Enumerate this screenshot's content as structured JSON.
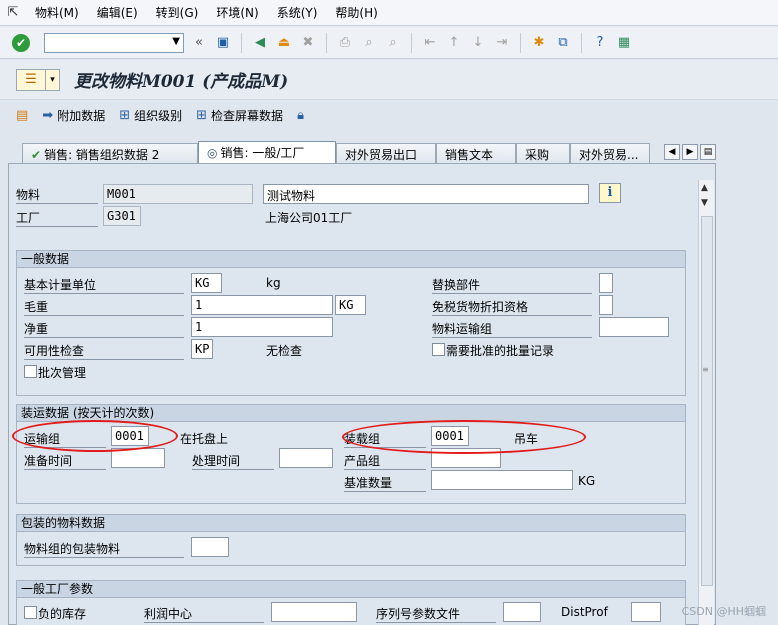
{
  "menubar": {
    "items": [
      "物料(M)",
      "编辑(E)",
      "转到(G)",
      "环境(N)",
      "系统(Y)",
      "帮助(H)"
    ]
  },
  "toolbar": {
    "icons": [
      "ok-icon",
      "back-icon",
      "exit-icon",
      "cancel-icon",
      "print-icon",
      "find-icon",
      "find-next-icon",
      "first-page-icon",
      "previous-page-icon",
      "next-page-icon",
      "last-page-icon",
      "create-session-icon",
      "shortcut-icon",
      "help-icon",
      "layout-icon"
    ]
  },
  "title": {
    "text": "更改物料M001 (产成品M)"
  },
  "appbar": {
    "additional_data": "附加数据",
    "org_levels": "组织级别",
    "check_screen_data": "检查屏幕数据"
  },
  "tabs": [
    {
      "label": "销售: 销售组织数据 2"
    },
    {
      "label": "销售: 一般/工厂"
    },
    {
      "label": "对外贸易出口"
    },
    {
      "label": "销售文本"
    },
    {
      "label": "采购"
    },
    {
      "label": "对外贸易..."
    }
  ],
  "header": {
    "material_label": "物料",
    "material_value": "M001",
    "material_desc": "测试物料",
    "plant_label": "工厂",
    "plant_value": "G301",
    "plant_desc": "上海公司01工厂"
  },
  "general": {
    "title": "一般数据",
    "base_uom_label": "基本计量单位",
    "base_uom_value": "KG",
    "base_uom_text": "kg",
    "gross_weight_label": "毛重",
    "gross_weight_value": "1",
    "gross_weight_unit": "KG",
    "net_weight_label": "净重",
    "net_weight_value": "1",
    "availability_label": "可用性检查",
    "availability_value": "KP",
    "availability_text": "无检查",
    "batch_label": "批次管理",
    "replacement_label": "替换部件",
    "tax_label": "免税货物折扣资格",
    "freight_label": "物料运输组",
    "approved_batch_label": "需要批准的批量记录"
  },
  "shipping": {
    "title": "装运数据 (按天计的次数)",
    "transport_label": "运输组",
    "transport_value": "0001",
    "transport_text": "在托盘上",
    "loading_label": "装载组",
    "loading_value": "0001",
    "loading_text": "吊车",
    "setup_label": "准备时间",
    "process_label": "处理时间",
    "product_group_label": "产品组",
    "base_qty_label": "基准数量",
    "base_qty_unit": "KG"
  },
  "packaging": {
    "title": "包装的物料数据",
    "matgroup_label": "物料组的包装物料"
  },
  "plant_params": {
    "title": "一般工厂参数",
    "neg_stock_label": "负的库存",
    "profit_center_label": "利润中心",
    "serial_label": "序列号参数文件",
    "distprof_label": "DistProf"
  },
  "watermark": "CSDN @HH蝈蝈"
}
